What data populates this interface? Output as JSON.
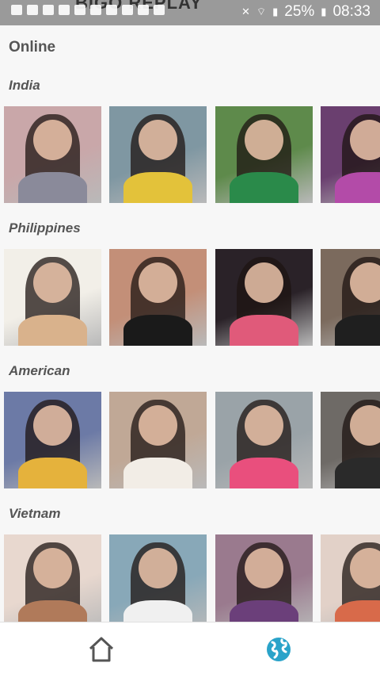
{
  "status_bar": {
    "ghost_title": "BIGO REPLAY",
    "battery": "25%",
    "time": "08:33"
  },
  "page": {
    "title": "Online"
  },
  "sections": [
    {
      "label": "India",
      "tiles": [
        {
          "bg": "#c9a7a9",
          "accent": "#8a8a9a"
        },
        {
          "bg": "#7f97a2",
          "accent": "#e3c23a"
        },
        {
          "bg": "#5e8a4b",
          "accent": "#2a8a4a"
        },
        {
          "bg": "#6a3f6f",
          "accent": "#b34ba8"
        }
      ]
    },
    {
      "label": "Philippines",
      "tiles": [
        {
          "bg": "#f2efe8",
          "accent": "#d9b28c"
        },
        {
          "bg": "#c38f78",
          "accent": "#1a1a1a"
        },
        {
          "bg": "#2a2228",
          "accent": "#e05a7a"
        },
        {
          "bg": "#7b6a5d",
          "accent": "#1f1f1f"
        }
      ]
    },
    {
      "label": "American",
      "tiles": [
        {
          "bg": "#6c7aa6",
          "accent": "#e5b23c"
        },
        {
          "bg": "#c0a896",
          "accent": "#f2ede6"
        },
        {
          "bg": "#9aa3a8",
          "accent": "#e94f7d"
        },
        {
          "bg": "#6e6a66",
          "accent": "#2a2a2a"
        }
      ]
    },
    {
      "label": "Vietnam",
      "tiles": [
        {
          "bg": "#e8d8cf",
          "accent": "#b07a5a"
        },
        {
          "bg": "#88a8b8",
          "accent": "#f0f0f0"
        },
        {
          "bg": "#9a7a8e",
          "accent": "#6b3f7a"
        },
        {
          "bg": "#e2d1c8",
          "accent": "#d86a4a"
        }
      ]
    }
  ],
  "colors": {
    "accent": "#2aa3c9",
    "nav_icon_inactive": "#555555",
    "label": "#555555"
  },
  "icons": {
    "home": "home-icon",
    "explore": "globe-icon"
  }
}
